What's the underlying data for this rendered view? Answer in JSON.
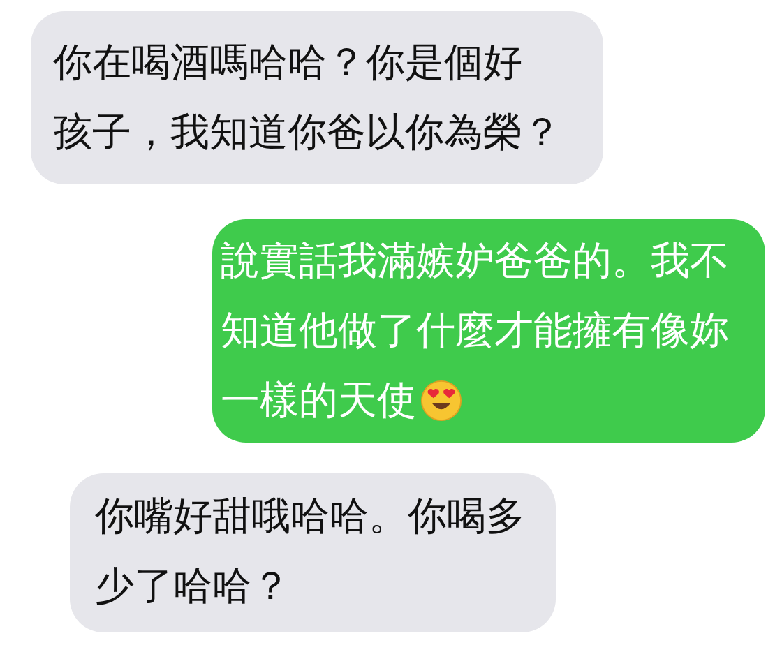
{
  "messages": [
    {
      "kind": "incoming",
      "lines": [
        "你在喝酒嗎哈哈？你是個好",
        "孩子，我知道你爸以你為榮？"
      ]
    },
    {
      "kind": "outgoing",
      "lines": [
        "說實話我滿嫉妒爸爸的。我不",
        "知道他做了什麼才能擁有像妳",
        "一樣的天使"
      ],
      "emoji": true
    },
    {
      "kind": "incoming",
      "lines": [
        "你嘴好甜哦哈哈。你喝多",
        "少了哈哈？"
      ]
    }
  ]
}
